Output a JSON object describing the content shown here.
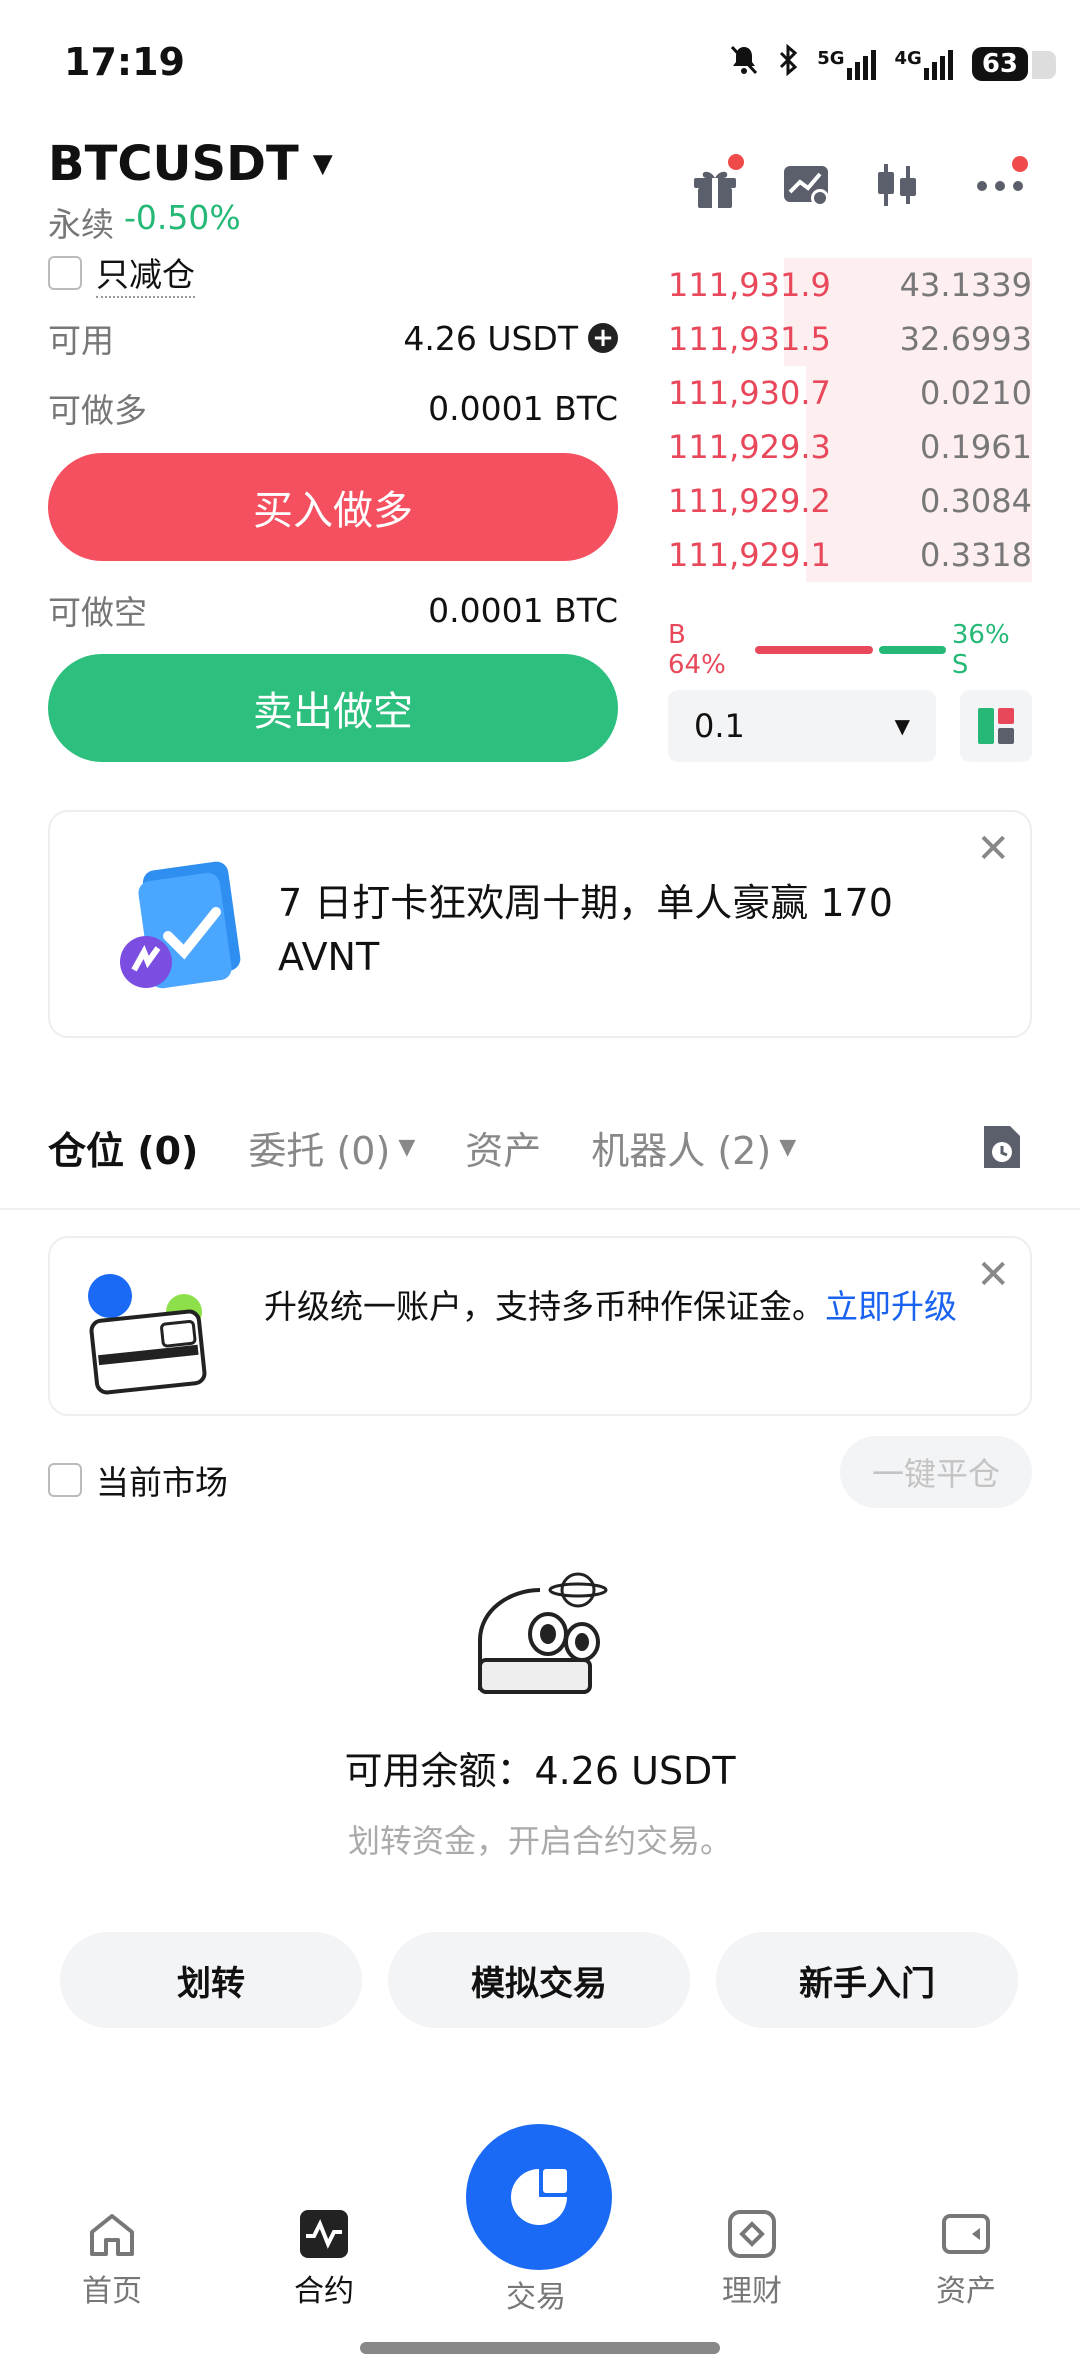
{
  "status_bar": {
    "time": "17:19",
    "network1": "5G",
    "network2": "4G",
    "battery": "63"
  },
  "header": {
    "symbol": "BTCUSDT",
    "type": "永续",
    "change": "-0.50%",
    "reduce_only": "只减仓"
  },
  "account": {
    "available_label": "可用",
    "available_value": "4.26 USDT",
    "long_label": "可做多",
    "long_value": "0.0001 BTC",
    "short_label": "可做空",
    "short_value": "0.0001 BTC",
    "buy_label": "买入做多",
    "sell_label": "卖出做空"
  },
  "orderbook": {
    "asks": [
      {
        "price": "111,931.9",
        "qty": "43.1339",
        "depth": 0.68
      },
      {
        "price": "111,931.5",
        "qty": "32.6993",
        "depth": 0.68
      },
      {
        "price": "111,930.7",
        "qty": "0.0210",
        "depth": 0.62
      },
      {
        "price": "111,929.3",
        "qty": "0.1961",
        "depth": 0.62
      },
      {
        "price": "111,929.2",
        "qty": "0.3084",
        "depth": 0.62
      },
      {
        "price": "111,929.1",
        "qty": "0.3318",
        "depth": 0.62
      }
    ],
    "buy_ratio": "B 64%",
    "sell_ratio": "36% S",
    "buy_fraction": 0.64,
    "depth_step": "0.1"
  },
  "promo": {
    "text": "7 日打卡狂欢周十期，单人豪赢 170 AVNT"
  },
  "tabs": [
    {
      "label": "仓位 (0)"
    },
    {
      "label": "委托 (0)"
    },
    {
      "label": "资产"
    },
    {
      "label": "机器人 (2)"
    }
  ],
  "upgrade": {
    "text": "升级统一账户，支持多币种作保证金。",
    "link": "立即升级"
  },
  "filter": {
    "current_market": "当前市场",
    "close_all": "一键平仓"
  },
  "empty_state": {
    "balance": "可用余额：4.26 USDT",
    "hint": "划转资金，开启合约交易。"
  },
  "actions": {
    "transfer": "划转",
    "demo": "模拟交易",
    "guide": "新手入门"
  },
  "nav": {
    "home": "首页",
    "futures": "合约",
    "trade": "交易",
    "earn": "理财",
    "assets": "资产"
  },
  "colors": {
    "buy": "#f4505f",
    "sell": "#2dbf7d",
    "accent": "#1a6af5"
  }
}
